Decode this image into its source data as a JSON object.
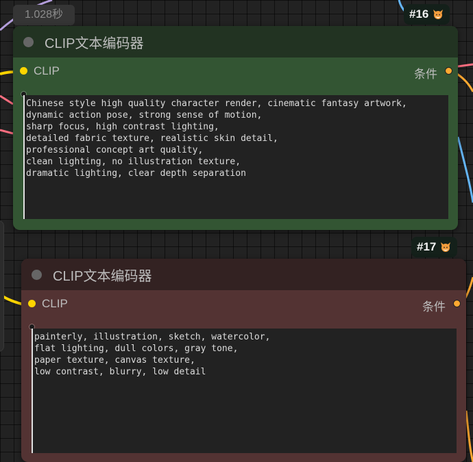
{
  "canvas": {
    "execution_time": "1.028秒"
  },
  "nodes": [
    {
      "id": "#16",
      "title": "CLIP文本编码器",
      "input_label": "CLIP",
      "output_label": "条件",
      "text": "Chinese style high quality character render, cinematic fantasy artwork,\ndynamic action pose, strong sense of motion,\nsharp focus, high contrast lighting,\ndetailed fabric texture, realistic skin detail,\nprofessional concept art quality,\nclean lighting, no illustration texture,\ndramatic lighting, clear depth separation",
      "color": "#335533",
      "header_color": "#223322"
    },
    {
      "id": "#17",
      "title": "CLIP文本编码器",
      "input_label": "CLIP",
      "output_label": "条件",
      "text": "painterly, illustration, sketch, watercolor,\nflat lighting, dull colors, gray tone,\npaper texture, canvas texture,\nlow contrast, blurry, low detail",
      "color": "#533333",
      "header_color": "#332222"
    }
  ],
  "icons": {
    "badge_icon": "fox-icon",
    "collapse_icon": "collapse-dot-icon"
  },
  "link_colors": {
    "clip": "#ffd500",
    "conditioning": "#ffa931",
    "model": "#b39ddb",
    "image": "#64b5f6",
    "latent": "#ff6e80"
  }
}
